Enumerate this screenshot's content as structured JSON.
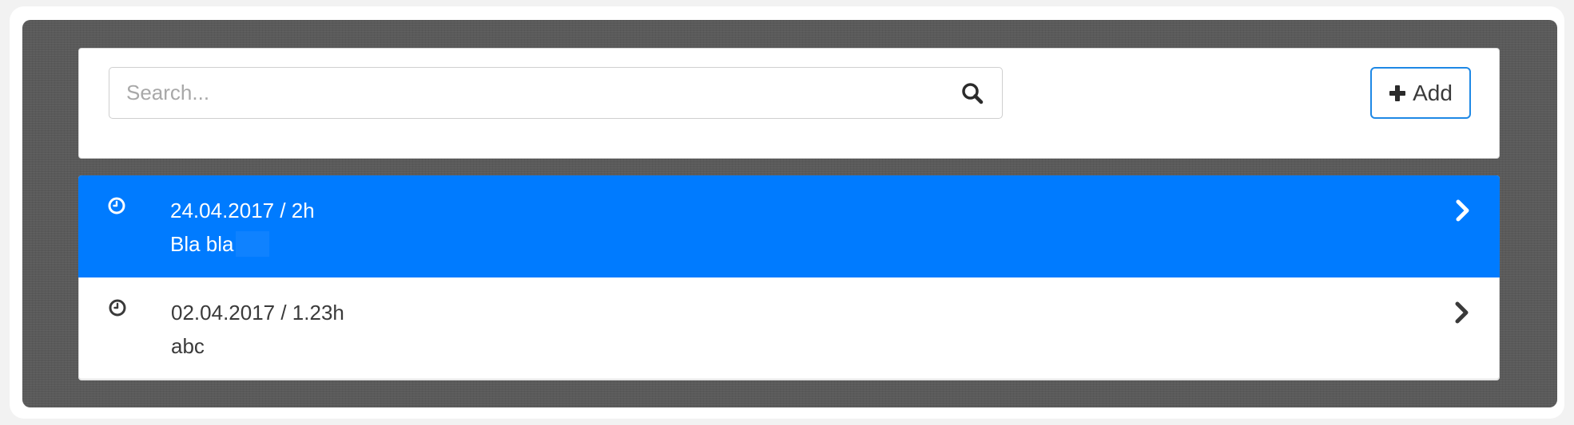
{
  "search": {
    "placeholder": "Search...",
    "icon": "search-icon"
  },
  "toolbar": {
    "add_label": "Add",
    "add_icon": "plus-icon"
  },
  "entries": [
    {
      "title": "24.04.2017 / 2h",
      "description": "Bla bla",
      "selected": true,
      "icon": "clock-icon"
    },
    {
      "title": "02.04.2017 / 1.23h",
      "description": "abc",
      "selected": false,
      "icon": "clock-icon"
    }
  ],
  "colors": {
    "accent": "#007bff",
    "button_border": "#1e88e5",
    "frame": "#5a5a5a",
    "text": "#3a3a3a"
  }
}
